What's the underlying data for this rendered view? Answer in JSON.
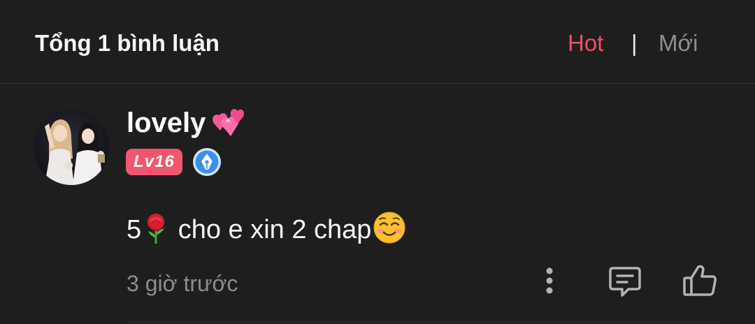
{
  "header": {
    "title": "Tổng 1 bình luận",
    "sort_hot": "Hot",
    "sort_divider": "|",
    "sort_new": "Mới",
    "active_sort": "Hot"
  },
  "comment": {
    "username": "lovely",
    "username_emoji_icon": "two-hearts-icon",
    "level": "Lv16",
    "badge_icon": "pen-nib-badge-icon",
    "text_before": "5",
    "text_middle": " cho e xin 2 chap",
    "rose_icon": "rose-icon",
    "smile_icon": "smiling-face-icon",
    "timestamp": "3 giờ trước",
    "actions": {
      "more_icon": "more-vertical-icon",
      "reply_icon": "reply-comment-icon",
      "like_icon": "thumbs-up-icon"
    }
  },
  "colors": {
    "background": "#1e1e1f",
    "accent": "#ee4f67",
    "level_badge": "#f2566d",
    "muted_text": "#8d8d90",
    "badge_blue": "#3a8fe8"
  }
}
